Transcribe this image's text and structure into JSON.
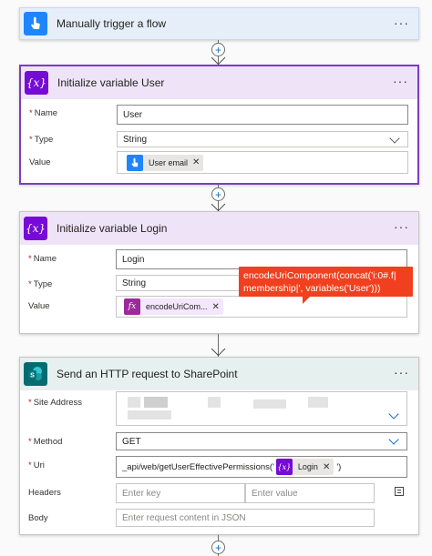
{
  "trigger": {
    "title": "Manually trigger a flow",
    "more": "···"
  },
  "init_user": {
    "title": "Initialize variable User",
    "icon": "{x}",
    "more": "···",
    "name_label": "Name",
    "name_value": "User",
    "type_label": "Type",
    "type_value": "String",
    "value_label": "Value",
    "value_token": "User email",
    "required_marker": "*"
  },
  "init_login": {
    "title": "Initialize variable Login",
    "icon": "{x}",
    "more": "···",
    "name_label": "Name",
    "name_value": "Login",
    "type_label": "Type",
    "type_value": "String",
    "value_label": "Value",
    "value_token": "encodeUriCom...",
    "required_marker": "*"
  },
  "tooltip": {
    "line1": "encodeUriComponent(concat('i:0#.f|",
    "line2": "membership|', variables('User')))"
  },
  "http": {
    "title": "Send an HTTP request to SharePoint",
    "icon": "S",
    "more": "···",
    "site_label": "Site Address",
    "method_label": "Method",
    "method_value": "GET",
    "uri_label": "Uri",
    "uri_prefix": "_api/web/getUserEffectivePermissions('",
    "uri_token": "Login",
    "uri_suffix": "')",
    "headers_label": "Headers",
    "header_key_placeholder": "Enter key",
    "header_value_placeholder": "Enter value",
    "body_label": "Body",
    "body_placeholder": "Enter request content in JSON",
    "required_marker": "*"
  },
  "token_icon_fx": "fx",
  "token_icon_var": "{x}",
  "remove_glyph": "✕",
  "plus_glyph": "+",
  "colors": {
    "trigger_accent": "#1f85ff",
    "variable_accent": "#770bd6",
    "sharepoint_accent": "#036c70",
    "tooltip_bg": "#f0401f",
    "required": "#a4262c"
  }
}
